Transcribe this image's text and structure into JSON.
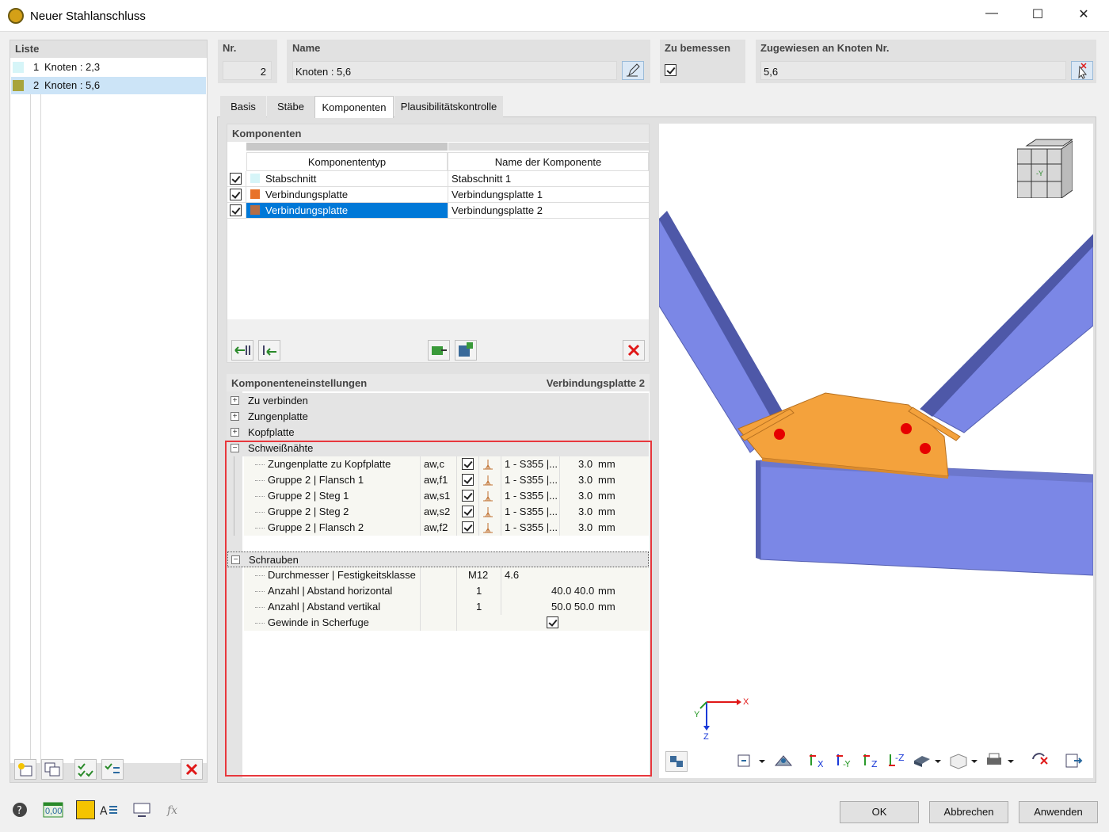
{
  "window": {
    "title": "Neuer Stahlanschluss",
    "minimize": "—",
    "maximize": "☐",
    "close": "✕"
  },
  "list": {
    "header": "Liste",
    "items": [
      {
        "no": "1",
        "label": "Knoten : 2,3",
        "color": "#d6f5f8"
      },
      {
        "no": "2",
        "label": "Knoten : 5,6",
        "color": "#a8a43c",
        "selected": true
      }
    ]
  },
  "fields": {
    "nr_label": "Nr.",
    "nr_value": "2",
    "name_label": "Name",
    "name_value": "Knoten : 5,6",
    "zu_bemessen_label": "Zu bemessen",
    "zu_bemessen_checked": true,
    "assigned_label": "Zugewiesen an Knoten Nr.",
    "assigned_value": "5,6"
  },
  "tabs": [
    {
      "label": "Basis"
    },
    {
      "label": "Stäbe"
    },
    {
      "label": "Komponenten",
      "active": true
    },
    {
      "label": "Plausibilitätskontrolle"
    }
  ],
  "components": {
    "header": "Komponenten",
    "col_type": "Komponententyp",
    "col_name": "Name der Komponente",
    "rows": [
      {
        "checked": true,
        "color": "#d6f5f8",
        "type": "Stabschnitt",
        "name": "Stabschnitt 1"
      },
      {
        "checked": true,
        "color": "#e8732a",
        "type": "Verbindungsplatte",
        "name": "Verbindungsplatte 1"
      },
      {
        "checked": true,
        "color": "#b56d45",
        "type": "Verbindungsplatte",
        "name": "Verbindungsplatte 2",
        "selected": true
      }
    ]
  },
  "settings": {
    "header": "Komponenteneinstellungen",
    "current": "Verbindungsplatte 2",
    "groups": {
      "zu_verbinden": "Zu verbinden",
      "zungenplatte": "Zungenplatte",
      "kopfplatte": "Kopfplatte",
      "schweissnaehte": "Schweißnähte",
      "schrauben": "Schrauben"
    },
    "welds": [
      {
        "label": "Zungenplatte zu Kopfplatte",
        "sym": "aw,c",
        "material": "1 - S355 |...",
        "value": "3.0",
        "unit": "mm"
      },
      {
        "label": "Gruppe 2 | Flansch 1",
        "sym": "aw,f1",
        "material": "1 - S355 |...",
        "value": "3.0",
        "unit": "mm"
      },
      {
        "label": "Gruppe 2 | Steg 1",
        "sym": "aw,s1",
        "material": "1 - S355 |...",
        "value": "3.0",
        "unit": "mm"
      },
      {
        "label": "Gruppe 2 | Steg 2",
        "sym": "aw,s2",
        "material": "1 - S355 |...",
        "value": "3.0",
        "unit": "mm"
      },
      {
        "label": "Gruppe 2 | Flansch 2",
        "sym": "aw,f2",
        "material": "1 - S355 |...",
        "value": "3.0",
        "unit": "mm"
      }
    ],
    "bolts": {
      "diameter_label": "Durchmesser | Festigkeitsklasse",
      "diameter": "M12",
      "grade": "4.6",
      "horiz_label": "Anzahl | Abstand horizontal",
      "horiz_count": "1",
      "horiz_dist": "40.0 40.0",
      "horiz_unit": "mm",
      "vert_label": "Anzahl | Abstand vertikal",
      "vert_count": "1",
      "vert_dist": "50.0 50.0",
      "vert_unit": "mm",
      "thread_label": "Gewinde in Scherfuge",
      "thread_checked": true
    }
  },
  "viewport": {
    "axis_x": "X",
    "axis_y": "Y",
    "axis_z": "Z",
    "cube_label": "-Y"
  },
  "buttons": {
    "ok": "OK",
    "cancel": "Abbrechen",
    "apply": "Anwenden"
  },
  "status": {
    "units_value": "0,00"
  },
  "colors": {
    "highlight": "#e8383d",
    "selection": "#0078d7",
    "beam": "#7b87e6",
    "plate": "#f4a23c"
  }
}
